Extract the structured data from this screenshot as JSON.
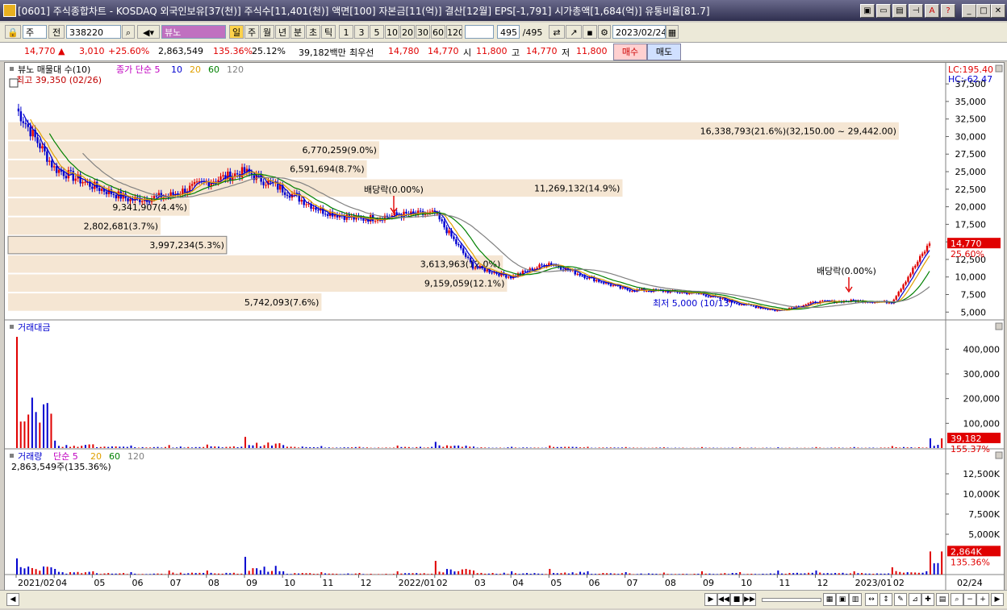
{
  "window": {
    "title": "[0601] 주식종합차트 - KOSDAQ 외국인보유[37(천)] 주식수[11,401(천)] 액면[100] 자본금[11(억)] 결산[12월] EPS[-1,791] 시가총액[1,684(억)] 유통비율[81.7]"
  },
  "toolbar": {
    "market": "주",
    "prefix": "전",
    "code": "338220",
    "indicator": "뷰노",
    "periods": [
      "일",
      "주",
      "월",
      "년",
      "분",
      "초",
      "틱"
    ],
    "intervals": [
      "1",
      "3",
      "5",
      "10",
      "20",
      "30",
      "60",
      "120"
    ],
    "count": "495",
    "count_total": "/495",
    "date": "2023/02/24"
  },
  "quote": {
    "price": "14,770",
    "change": "3,010",
    "change_pct": "+25.60%",
    "volume": "2,863,549",
    "volume_ratio": "135.36%",
    "turnover": "25.12%",
    "amount": "39,182백만",
    "best_label": "최우선",
    "ask": "14,780",
    "bid": "14,770",
    "open_label": "시",
    "open": "11,800",
    "high_label": "고",
    "high": "14,770",
    "low_label": "저",
    "low": "11,800",
    "buy": "매수",
    "sell": "매도"
  },
  "price_panel": {
    "legend_name": "뷰노 매물대 수(10)",
    "legend_ma": "종가 단순 5",
    "legend_periods": [
      "10",
      "20",
      "60",
      "120"
    ],
    "legend_colors": [
      "#0000d0",
      "#e0a000",
      "#008000",
      "#808080"
    ],
    "high_note": "최고 39,350 (02/26)",
    "low_note": "최저 5,000 (10/13)",
    "lc": "LC:195.40",
    "hc": "HC:-62.47",
    "current_price": "14,770",
    "current_pct": "25.60%",
    "dividend_label": "배당락(0.00%)"
  },
  "volume_profile": [
    {
      "label": "16,338,793(21.6%)(32,150.00 ~ 29,442.00)",
      "low": 29442,
      "high": 32150,
      "pct": 21.6
    },
    {
      "label": "6,770,259(9.0%)",
      "low": 26734,
      "high": 29442,
      "pct": 9.0
    },
    {
      "label": "6,591,694(8.7%)",
      "low": 24026,
      "high": 26734,
      "pct": 8.7
    },
    {
      "label": "11,269,132(14.9%)",
      "low": 21318,
      "high": 24026,
      "pct": 14.9
    },
    {
      "label": "9,341,907(4.4%)",
      "low": 18610,
      "high": 21318,
      "pct": 4.4
    },
    {
      "label": "2,802,681(3.7%)",
      "low": 15902,
      "high": 18610,
      "pct": 3.7
    },
    {
      "label": "3,997,234(5.3%)",
      "low": 13194,
      "high": 15902,
      "pct": 5.3
    },
    {
      "label": "3,613,963(12.0%)",
      "low": 10486,
      "high": 13194,
      "pct": 12.0
    },
    {
      "label": "9,159,059(12.1%)",
      "low": 7778,
      "high": 10486,
      "pct": 12.1
    },
    {
      "label": "5,742,093(7.6%)",
      "low": 5070,
      "high": 7778,
      "pct": 7.6
    }
  ],
  "amount_panel": {
    "legend": "거래대금",
    "value": "39,182",
    "pct": "155.37%"
  },
  "volume_panel": {
    "legend": "거래량",
    "legend_ma": "단순 5",
    "legend_periods": [
      "20",
      "60",
      "120"
    ],
    "note": "2,863,549주(135.36%)",
    "value": "2,864K",
    "pct": "135.36%"
  },
  "chart_data": [
    {
      "type": "candlestick",
      "title": "",
      "ylim": [
        4000,
        39350
      ],
      "y_ticks": [
        5000,
        7500,
        10000,
        12500,
        15000,
        17500,
        20000,
        22500,
        25000,
        27500,
        30000,
        32500,
        35000,
        37500
      ],
      "x_ticks": [
        "2021/02",
        "04",
        "05",
        "06",
        "07",
        "08",
        "09",
        "10",
        "11",
        "12",
        "2022/01",
        "02",
        "03",
        "04",
        "05",
        "06",
        "07",
        "08",
        "09",
        "10",
        "11",
        "12",
        "2023/01",
        "02",
        "02/24"
      ],
      "x": [
        "2021-02",
        "2021-03",
        "2021-04",
        "2021-05",
        "2021-06",
        "2021-07",
        "2021-08",
        "2021-09",
        "2021-10",
        "2021-11",
        "2021-12",
        "2022-01",
        "2022-02",
        "2022-03",
        "2022-04",
        "2022-05",
        "2022-06",
        "2022-07",
        "2022-08",
        "2022-09",
        "2022-10",
        "2022-11",
        "2022-12",
        "2023-01",
        "2023-02"
      ],
      "close": [
        34000,
        25500,
        23000,
        21000,
        21500,
        23500,
        25000,
        22500,
        19500,
        18200,
        18800,
        19000,
        11500,
        10000,
        12000,
        10000,
        8200,
        8000,
        7600,
        6200,
        5200,
        6400,
        6600,
        6400,
        14770
      ]
    },
    {
      "type": "bar",
      "title": "",
      "ylim": [
        0,
        450000
      ],
      "y_ticks": [
        100000,
        200000,
        300000,
        400000
      ],
      "x": [
        "2021-02",
        "2021-03",
        "2021-04",
        "2021-05",
        "2021-06",
        "2021-07",
        "2021-08",
        "2021-09",
        "2021-10",
        "2021-11",
        "2021-12",
        "2022-01",
        "2022-02",
        "2022-03",
        "2022-04",
        "2022-05",
        "2022-06",
        "2022-07",
        "2022-08",
        "2022-09",
        "2022-10",
        "2022-11",
        "2022-12",
        "2023-01",
        "2023-02"
      ],
      "values": [
        450000,
        30000,
        15000,
        10000,
        12000,
        14000,
        45000,
        12000,
        8000,
        5000,
        10000,
        25000,
        6000,
        5000,
        10000,
        5000,
        4000,
        3000,
        4000,
        3000,
        3000,
        4000,
        4000,
        8000,
        39182
      ]
    },
    {
      "type": "bar",
      "title": "",
      "ylim": [
        0,
        13500
      ],
      "y_ticks": [
        5000,
        7500,
        10000,
        12500
      ],
      "x": [
        "2021-02",
        "2021-03",
        "2021-04",
        "2021-05",
        "2021-06",
        "2021-07",
        "2021-08",
        "2021-09",
        "2021-10",
        "2021-11",
        "2021-12",
        "2022-01",
        "2022-02",
        "2022-03",
        "2022-04",
        "2022-05",
        "2022-06",
        "2022-07",
        "2022-08",
        "2022-09",
        "2022-10",
        "2022-11",
        "2022-12",
        "2023-01",
        "2023-02"
      ],
      "values": [
        2000,
        700,
        400,
        300,
        500,
        500,
        2200,
        400,
        300,
        200,
        400,
        1700,
        500,
        400,
        700,
        400,
        300,
        250,
        400,
        300,
        500,
        500,
        400,
        900,
        2864
      ]
    }
  ]
}
